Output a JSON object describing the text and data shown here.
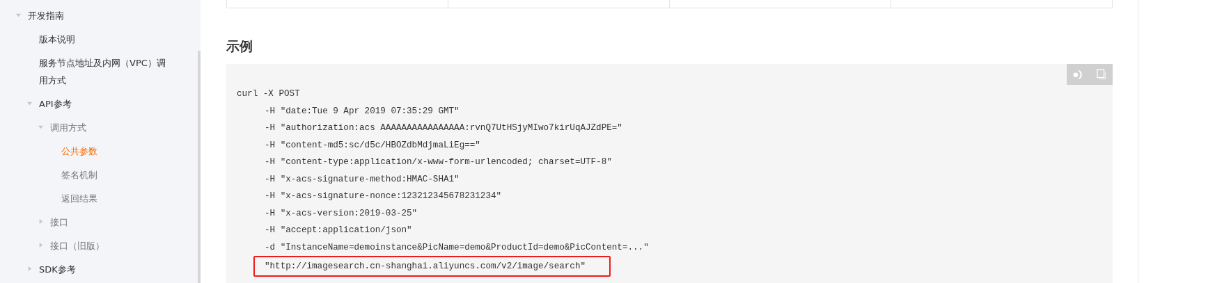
{
  "sidebar": {
    "items": [
      {
        "label": "开发指南",
        "expanded": true,
        "selected": false,
        "children": [
          {
            "label": "版本说明",
            "selected": false
          },
          {
            "label": "服务节点地址及内网（VPC）调用方式",
            "selected": false
          },
          {
            "label": "API参考",
            "expanded": true,
            "selected": false,
            "children": [
              {
                "label": "调用方式",
                "expanded": true,
                "selected": false,
                "children": [
                  {
                    "label": "公共参数",
                    "selected": true
                  },
                  {
                    "label": "签名机制",
                    "selected": false
                  },
                  {
                    "label": "返回结果",
                    "selected": false
                  }
                ]
              },
              {
                "label": "接口",
                "expanded": false,
                "selected": false
              },
              {
                "label": "接口（旧版）",
                "expanded": false,
                "selected": false
              }
            ]
          },
          {
            "label": "SDK参考",
            "expanded": false,
            "selected": false
          }
        ]
      }
    ]
  },
  "section": {
    "title": "示例",
    "code_lines": [
      {
        "text": "curl -X POST",
        "highlighted": false
      },
      {
        "text": "-H \"date:Tue 9 Apr 2019 07:35:29 GMT\"",
        "highlighted": false
      },
      {
        "text": "-H \"authorization:acs AAAAAAAAAAAAAAAA:rvnQ7UtHSjyMIwo7kirUqAJZdPE=\"",
        "highlighted": false
      },
      {
        "text": "-H \"content-md5:sc/d5c/HBOZdbMdjmaLiEg==\"",
        "highlighted": false
      },
      {
        "text": "-H \"content-type:application/x-www-form-urlencoded; charset=UTF-8\"",
        "highlighted": false
      },
      {
        "text": "-H \"x-acs-signature-method:HMAC-SHA1\"",
        "highlighted": false
      },
      {
        "text": "-H \"x-acs-signature-nonce:123212345678231234\"",
        "highlighted": false
      },
      {
        "text": "-H \"x-acs-version:2019-03-25\"",
        "highlighted": false
      },
      {
        "text": "-H \"accept:application/json\"",
        "highlighted": false
      },
      {
        "text": "-d \"InstanceName=demoinstance&PicName=demo&ProductId=demo&PicContent=...\"",
        "highlighted": false
      },
      {
        "text": "\"http://imagesearch.cn-shanghai.aliyuncs.com/v2/image/search\"",
        "highlighted": true
      }
    ]
  }
}
